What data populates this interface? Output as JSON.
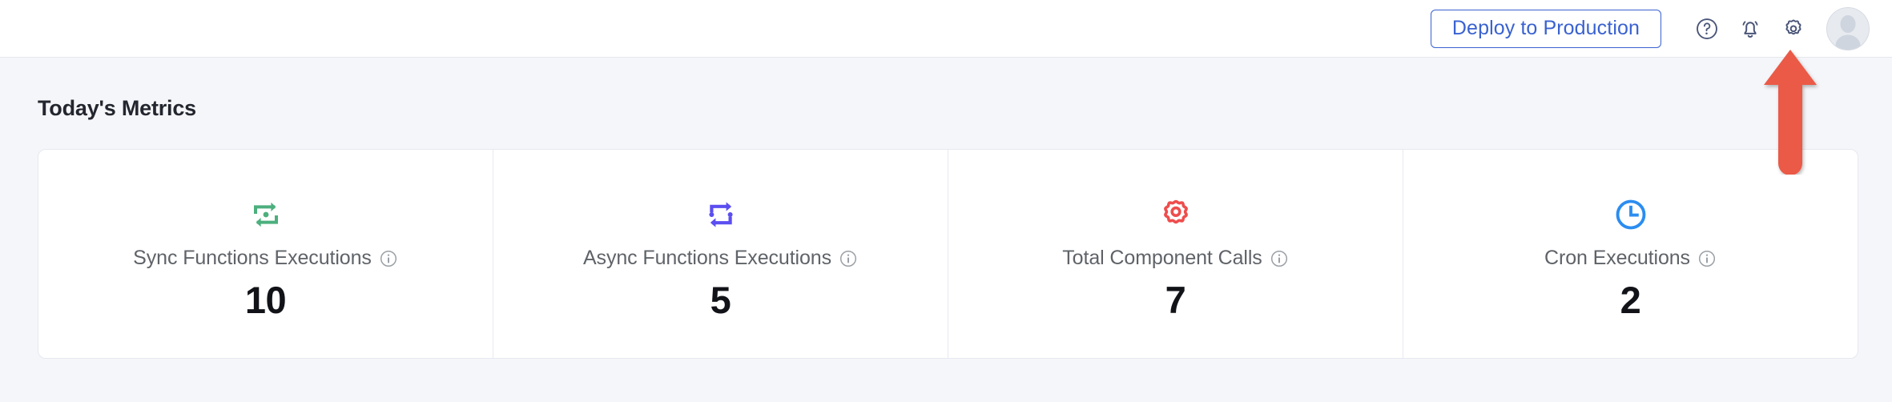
{
  "header": {
    "deploy_button_label": "Deploy to Production",
    "deploy_button_color": "#3a62d0",
    "icons": [
      {
        "name": "help-icon",
        "glyph": "?"
      },
      {
        "name": "notification-bell-icon",
        "glyph": "bell"
      },
      {
        "name": "settings-gear-icon",
        "glyph": "gear"
      },
      {
        "name": "user-avatar",
        "glyph": "avatar"
      }
    ],
    "icon_color": "#4a5578"
  },
  "main": {
    "section_title": "Today's Metrics",
    "metrics": [
      {
        "label": "Sync Functions Executions",
        "value": "10",
        "icon": "sync-loop-icon",
        "icon_color": "#4caf7d",
        "info_icon": "info-icon"
      },
      {
        "label": "Async Functions Executions",
        "value": "5",
        "icon": "async-loop-icon",
        "icon_color": "#5b4ef0",
        "info_icon": "info-icon"
      },
      {
        "label": "Total Component Calls",
        "value": "7",
        "icon": "gear-icon",
        "icon_color": "#ef4d4d",
        "info_icon": "info-icon"
      },
      {
        "label": "Cron Executions",
        "value": "2",
        "icon": "clock-icon",
        "icon_color": "#2b8df0",
        "info_icon": "info-icon"
      }
    ]
  },
  "annotation": {
    "arrow_name": "pointer-arrow-to-settings",
    "arrow_color": "#ea5a47",
    "points_at": "settings-gear-icon"
  },
  "theme": {
    "page_background": "#f5f6f9",
    "surface": "#ffffff",
    "border": "#e7e9f1",
    "text_primary": "#111318",
    "text_secondary": "#5f6368"
  }
}
